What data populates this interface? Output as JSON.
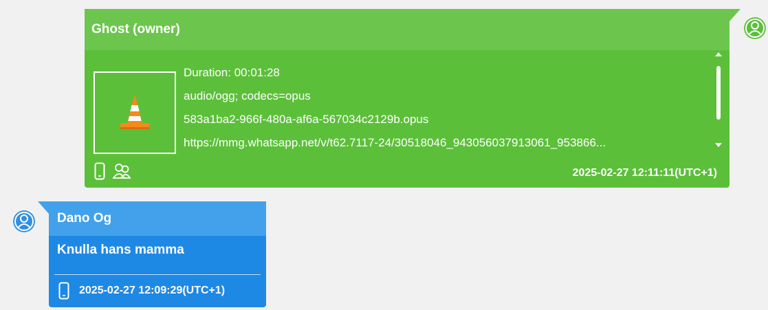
{
  "messages": [
    {
      "sender": "Ghost (owner)",
      "attachment_icon": "vlc-cone-icon",
      "meta": {
        "duration": "Duration: 00:01:28",
        "mime": "audio/ogg; codecs=opus",
        "filename": "583a1ba2-966f-480a-af6a-567034c2129b.opus",
        "url": "https://mmg.whatsapp.net/v/t62.7117-24/30518046_943056037913061_953866..."
      },
      "timestamp": "2025-02-27 12:11:11(UTC+1)",
      "footer_icons": [
        "phone-icon",
        "group-icon"
      ],
      "colors": {
        "header": "#6cc64e",
        "body": "#5cbf3a"
      }
    },
    {
      "sender": "Dano Og",
      "text": "Knulla hans mamma",
      "timestamp": "2025-02-27 12:09:29(UTC+1)",
      "footer_icons": [
        "phone-icon"
      ],
      "colors": {
        "header": "#42a1ea",
        "body": "#1e88e5"
      }
    }
  ]
}
